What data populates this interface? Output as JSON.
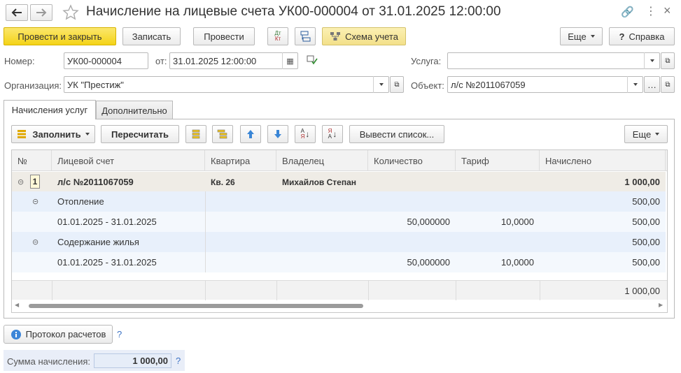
{
  "window": {
    "title": "Начисление на лицевые счета УК00-000004 от 31.01.2025 12:00:00",
    "back_icon": "arrow-left-icon",
    "forward_icon": "arrow-right-icon",
    "star_icon": "star-icon"
  },
  "toolbar": {
    "post_close": "Провести и закрыть",
    "save": "Записать",
    "post": "Провести",
    "dt_kt_icon": "Дт Кт",
    "scheme": "Схема учета",
    "more": "Еще",
    "help": "Справка"
  },
  "form": {
    "number_label": "Номер:",
    "number_value": "УК00-000004",
    "date_label": "от:",
    "date_value": "31.01.2025 12:00:00",
    "org_label": "Организация:",
    "org_value": "УК \"Престиж\"",
    "service_label": "Услуга:",
    "service_value": "",
    "object_label": "Объект:",
    "object_value": "л/с №2011067059"
  },
  "tabs": [
    {
      "label": "Начисления услуг",
      "active": true
    },
    {
      "label": "Дополнительно",
      "active": false
    }
  ],
  "table_toolbar": {
    "fill": "Заполнить",
    "recalc": "Пересчитать",
    "output_list": "Вывести список...",
    "more": "Еще"
  },
  "table": {
    "columns": [
      "№",
      "Лицевой счет",
      "Квартира",
      "Владелец",
      "Количество",
      "Тариф",
      "Начислено"
    ],
    "group_row": {
      "num": "1",
      "account": "л/с №2011067059",
      "apartment": "Кв. 26",
      "owner": "Михайлов Степан",
      "quantity": "",
      "tariff": "",
      "total": "1 000,00"
    },
    "rows": [
      {
        "label": "Отопление",
        "quantity": "",
        "tariff": "",
        "total": "500,00",
        "type": "service"
      },
      {
        "label": "01.01.2025 - 31.01.2025",
        "quantity": "50,000000",
        "tariff": "10,0000",
        "total": "500,00",
        "type": "period"
      },
      {
        "label": "Содержание жилья",
        "quantity": "",
        "tariff": "",
        "total": "500,00",
        "type": "service"
      },
      {
        "label": "01.01.2025 - 31.01.2025",
        "quantity": "50,000000",
        "tariff": "10,0000",
        "total": "500,00",
        "type": "period"
      }
    ],
    "footer_total": "1 000,00"
  },
  "bottom": {
    "protocol": "Протокол расчетов",
    "help_mark": "?",
    "sum_label": "Сумма начисления:",
    "sum_value": "1 000,00"
  }
}
